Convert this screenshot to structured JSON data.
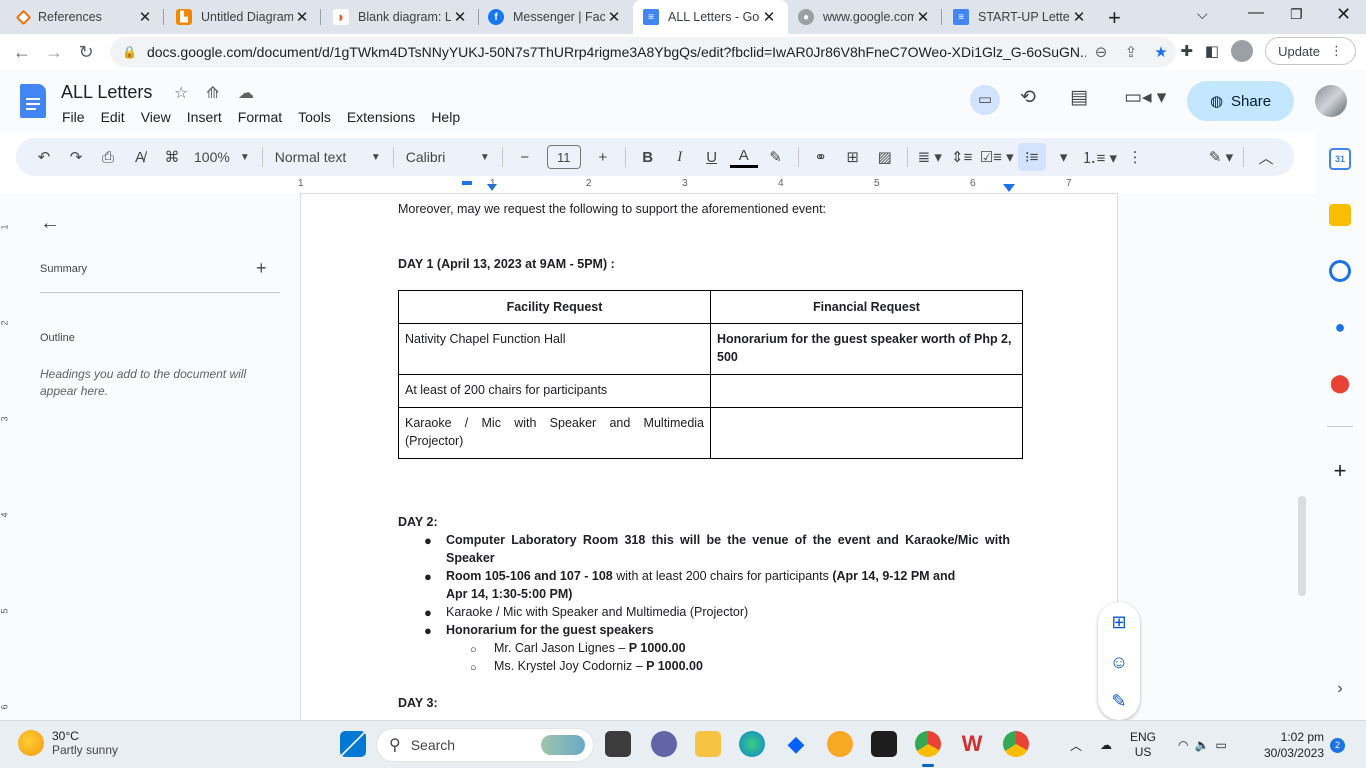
{
  "tabs": [
    {
      "title": "References",
      "icon_color": "#e8710a"
    },
    {
      "title": "Untitled Diagram",
      "icon_color": "#f08705"
    },
    {
      "title": "Blank diagram: Lu",
      "icon_color": "#f05a28"
    },
    {
      "title": "Messenger | Face",
      "icon_color": "#1877f2"
    },
    {
      "title": "ALL Letters - Goo",
      "icon_color": "#4285f4"
    },
    {
      "title": "www.google.com",
      "icon_color": "#9aa0a6"
    },
    {
      "title": "START-UP Letter",
      "icon_color": "#4285f4"
    }
  ],
  "browser": {
    "url": "docs.google.com/document/d/1gTWkm4DTsNNyYUKJ-50N7s7ThURrp4rigme3A8YbgQs/edit?fbclid=IwAR0Jr86V8hFneC7OWeo-XDi1Glz_G-6oSuGN...",
    "update_label": "Update"
  },
  "doc": {
    "title": "ALL Letters",
    "menus": [
      "File",
      "Edit",
      "View",
      "Insert",
      "Format",
      "Tools",
      "Extensions",
      "Help"
    ],
    "share_label": "Share"
  },
  "toolbar": {
    "zoom": "100%",
    "style": "Normal text",
    "font": "Calibri",
    "font_size": "11"
  },
  "ruler": [
    "1",
    "1",
    "2",
    "3",
    "4",
    "5",
    "6",
    "7"
  ],
  "vruler": [
    "1",
    "2",
    "3",
    "4",
    "5",
    "6"
  ],
  "outline": {
    "summary": "Summary",
    "outline": "Outline",
    "hint": "Headings you add to the document will appear here."
  },
  "content": {
    "intro": "Moreover, may we request the following to support the aforementioned event:",
    "day1": "DAY 1 (April 13, 2023 at 9AM - 5PM) :",
    "table_headers": [
      "Facility Request",
      "Financial Request"
    ],
    "table_rows": [
      [
        "Nativity Chapel Function Hall",
        "Honorarium for the guest speaker worth of Php 2, 500"
      ],
      [
        "At least of 200 chairs for participants",
        ""
      ],
      [
        "Karaoke / Mic with Speaker and Multimedia (Projector)",
        ""
      ]
    ],
    "day2": "DAY 2:",
    "b1_line1": "Computer Laboratory Room 318 this will be the venue of the event and Karaoke/Mic with",
    "b1_line2": "Speaker",
    "b2_bold1": "Room 105-106 and 107 - 108",
    "b2_normal": " with at least 200 chairs for participants ",
    "b2_bold2": "(Apr 14, 9-12 PM and",
    "b2_line2": "Apr 14, 1:30-5:00 PM)",
    "b3": "Karaoke / Mic with Speaker and Multimedia (Projector)",
    "b4": "Honorarium for the guest speakers",
    "s1_name": "Mr. Carl Jason Lignes – ",
    "s1_amt": "P 1000.00",
    "s2_name": "Ms. Krystel Joy Codorniz – ",
    "s2_amt": "P 1000.00",
    "day3": "DAY 3:"
  },
  "taskbar": {
    "temp": "30°C",
    "weather": "Partly sunny",
    "search": "Search",
    "lang1": "ENG",
    "lang2": "US",
    "time": "1:02 pm",
    "date": "30/03/2023",
    "notif": "2"
  }
}
